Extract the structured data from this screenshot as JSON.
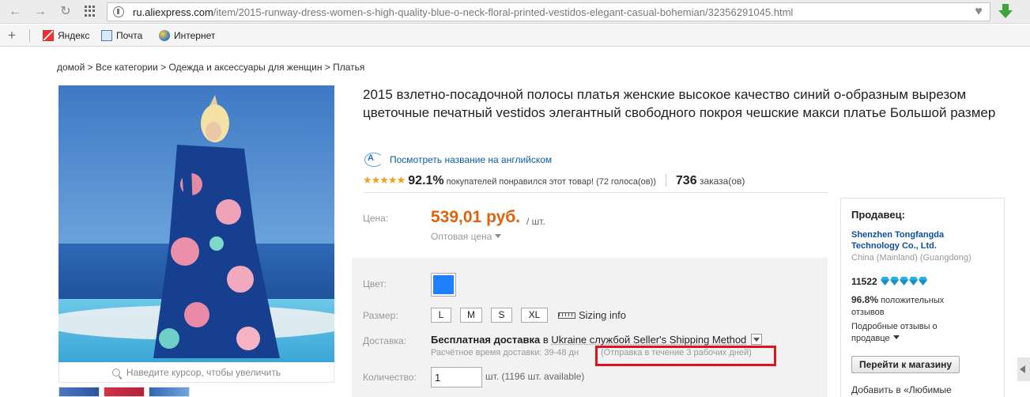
{
  "browser": {
    "url_domain": "ru.aliexpress.com",
    "url_path": "/item/2015-runway-dress-women-s-high-quality-blue-o-neck-floral-printed-vestidos-elegant-casual-bohemian/32356291045.html",
    "bookmarks": [
      {
        "label": "Яндекс",
        "icon": "yandex-icon"
      },
      {
        "label": "Почта",
        "icon": "mail-icon"
      },
      {
        "label": "Интернет",
        "icon": "globe-icon"
      }
    ]
  },
  "breadcrumb": "домой > Все категории > Одежда и аксессуары для женщин > Платья",
  "product": {
    "title": "2015 взлетно-посадочной полосы платья женские высокое качество синий о-образным вырезом цветочные печатный vestidos элегантный свободного покроя чешские макси платье Большой размер",
    "translate_link": "Посмотреть название на английском",
    "translate_icon_text": "A",
    "rating_fraction": 0.921,
    "rating_pct": "92.1%",
    "rating_text": "покупателей понравился этот товар! (72 голоса(ов))",
    "orders_count": "736",
    "orders_text": "заказа(ов)",
    "price_label": "Цена:",
    "price": "539,01 руб.",
    "price_unit": "/ шт.",
    "wholesale": "Оптовая цена",
    "zoom_hint": "Наведите курсор, чтобы увеличить"
  },
  "options": {
    "color_label": "Цвет:",
    "color_value": "#1e80ff",
    "size_label": "Размер:",
    "sizes": [
      "L",
      "M",
      "S",
      "XL"
    ],
    "sizing_info": "Sizing info",
    "shipping_label": "Доставка:",
    "shipping_free": "Бесплатная доставка",
    "shipping_in": "в",
    "shipping_dest": "Ukraine службой Seller's Shipping Method",
    "shipping_time": "Расчётное время доставки: 39-48 дн",
    "shipping_note": "(Отправка в течение 3 рабочих дней)",
    "quantity_label": "Количество:",
    "quantity_value": "1",
    "quantity_available": "шт. (1196 шт. available)"
  },
  "seller": {
    "title": "Продавец:",
    "name": "Shenzhen Tongfangda Technology Co., Ltd.",
    "location": "China (Mainland) (Guangdong)",
    "score": "11522",
    "positive_pct": "96.8%",
    "positive_text": "положительных отзывов",
    "detail_text": "Подробные отзывы о продавце",
    "store_button": "Перейти к магазину",
    "favorite_text": "Добавить в «Любимые"
  },
  "colors": {
    "accent_price": "#e0620d",
    "link": "#0d5ea8",
    "highlight": "#e0141e"
  }
}
